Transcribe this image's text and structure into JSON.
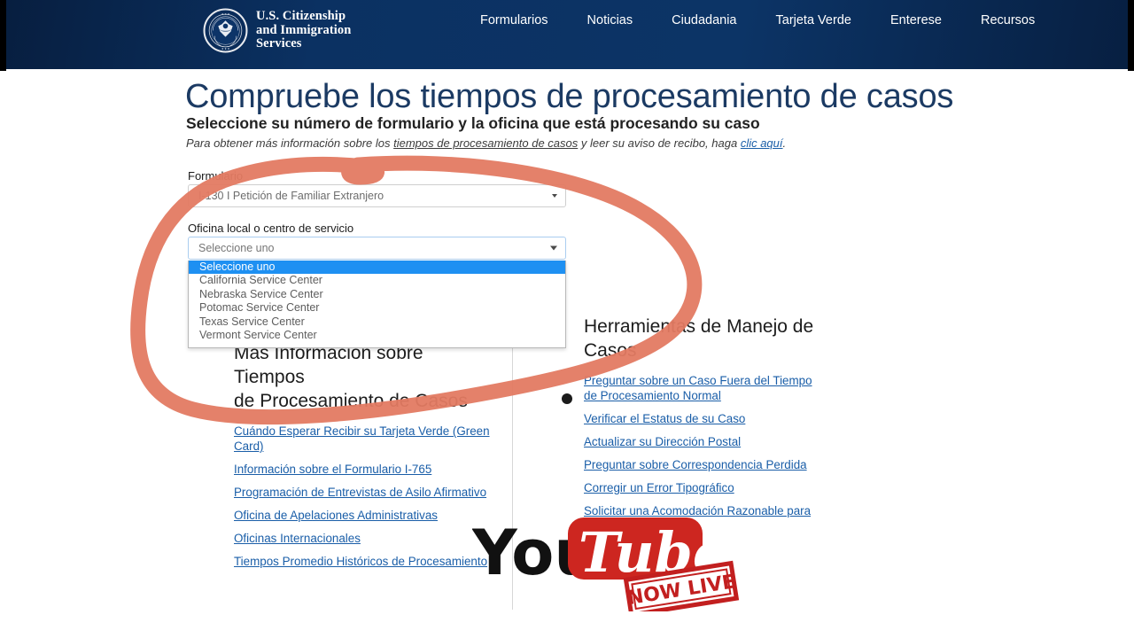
{
  "header": {
    "agency_name_lines": [
      "U.S. Citizenship",
      "and Immigration",
      "Services"
    ],
    "seal_icon": "dhs-seal-icon",
    "bg_color": "#0a2c5a",
    "nav": [
      {
        "label": "Formularios"
      },
      {
        "label": "Noticias"
      },
      {
        "label": "Ciudadania"
      },
      {
        "label": "Tarjeta Verde"
      },
      {
        "label": "Enterese"
      },
      {
        "label": "Recursos"
      }
    ]
  },
  "main": {
    "title": "Compruebe los tiempos de procesamiento de casos",
    "subtitle": "Seleccione su número de formulario y la oficina que está procesando su caso",
    "note": {
      "part1": "Para obtener más información sobre los ",
      "underlined": "tiempos de procesamiento de casos",
      "part2": " y leer su aviso de recibo, haga ",
      "link": "clic aquí",
      "part3": "."
    }
  },
  "form": {
    "form_label": "Formulario",
    "form_value": "I-130 I Petición de Familiar Extranjero",
    "office_label": "Oficina local o centro de servicio",
    "office_value": "Seleccione uno",
    "office_options": [
      "Seleccione uno",
      "California Service Center",
      "Nebraska Service Center",
      "Potomac Service Center",
      "Texas Service Center",
      "Vermont Service Center"
    ],
    "office_selected_index": 0,
    "caret_icon": "chevron-down-icon"
  },
  "columns": {
    "left": {
      "heading_line1": "Más Información sobre Tiempos",
      "heading_line2": "de Procesamiento de Casos",
      "links": [
        "Cuándo Esperar Recibir su Tarjeta Verde (Green Card)",
        "Información sobre el Formulario I-765",
        "Programación de Entrevistas de Asilo Afirmativo",
        "Oficina de Apelaciones Administrativas",
        "Oficinas Internacionales",
        "Tiempos Promedio Históricos de Procesamiento"
      ]
    },
    "right": {
      "heading_line1": "Herramientas de Manejo de",
      "heading_line2": "Casos",
      "links": [
        "Preguntar sobre un Caso Fuera del Tiempo de Procesamiento Normal",
        "Verificar el Estatus de su Caso",
        "Actualizar su Dirección Postal",
        "Preguntar sobre Correspondencia Perdida",
        "Corregir un Error Tipográfico",
        "Solicitar una Acomodación Razonable para Cita"
      ]
    }
  },
  "annotation": {
    "shape": "hand-drawn-ellipse",
    "color": "#e37a62",
    "description": "Red-orange circle highlighting the form and dropdown area"
  },
  "watermark": {
    "brand_you": "You",
    "brand_tube": "Tube",
    "stamp": "NOW LIVE",
    "red": "#cd2620",
    "stamp_red": "#c21f1f"
  },
  "link_color": "#1a5ea8",
  "title_color": "#1b3a63"
}
